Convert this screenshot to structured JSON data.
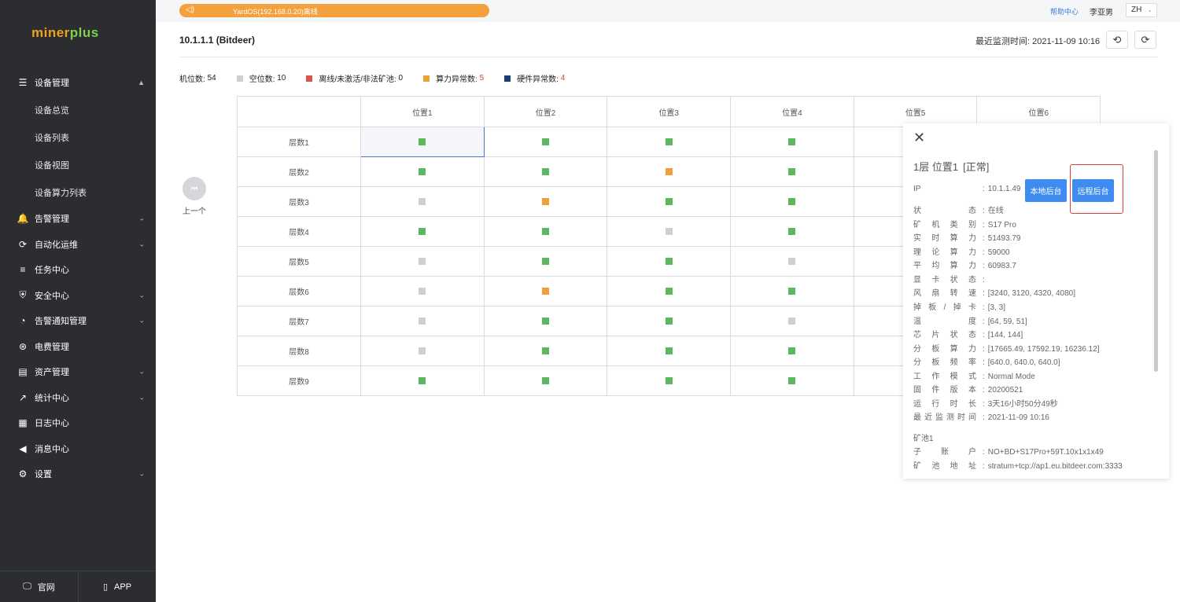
{
  "sidebar": {
    "logo_left": "miner",
    "logo_right": "plus",
    "menu": [
      {
        "label": "设备管理",
        "icon": "list-icon",
        "expanded": true
      },
      {
        "label": "告警管理",
        "icon": "bell-icon"
      },
      {
        "label": "自动化运维",
        "icon": "refresh-icon"
      },
      {
        "label": "任务中心",
        "icon": "task-list-icon"
      },
      {
        "label": "安全中心",
        "icon": "shield-icon"
      },
      {
        "label": "告警通知管理",
        "icon": "notify-icon"
      },
      {
        "label": "电费管理",
        "icon": "money-icon"
      },
      {
        "label": "资产管理",
        "icon": "assets-icon"
      },
      {
        "label": "统计中心",
        "icon": "trend-icon"
      },
      {
        "label": "日志中心",
        "icon": "log-icon"
      },
      {
        "label": "消息中心",
        "icon": "speaker-icon"
      },
      {
        "label": "设置",
        "icon": "gear-icon"
      }
    ],
    "submenu": [
      "设备总览",
      "设备列表",
      "设备视图",
      "设备算力列表"
    ],
    "bottom": {
      "website": "官网",
      "app": "APP"
    }
  },
  "topbar": {
    "notice": "YardOS(192.168.0.20)离线",
    "help": "帮助中心",
    "user": "李亚男",
    "lang": "ZH"
  },
  "header": {
    "title": "10.1.1.1 (Bitdeer)",
    "last_check": "最近监测时间: 2021-11-09 10:16"
  },
  "legend": {
    "total_label": "机位数:",
    "total_value": "54",
    "empty_label": "空位数:",
    "empty_value": "10",
    "offline_label": "离线/未激活/非法矿池:",
    "offline_value": "0",
    "hash_label": "算力异常数:",
    "hash_value": "5",
    "hw_label": "硬件异常数:",
    "hw_value": "4",
    "colors": {
      "normal": "#5cb85c",
      "empty": "#cfcfcf",
      "offline": "#d9534f",
      "hash": "#f0a03a",
      "hw": "#1b3f74"
    }
  },
  "nav": {
    "prev": "上一个"
  },
  "grid": {
    "columns": [
      "位置1",
      "位置2",
      "位置3",
      "位置4",
      "位置5",
      "位置6"
    ],
    "rows": [
      {
        "label": "层数1",
        "cells": [
          "normal",
          "normal",
          "normal",
          "normal"
        ]
      },
      {
        "label": "层数2",
        "cells": [
          "normal",
          "normal",
          "hash",
          "normal"
        ]
      },
      {
        "label": "层数3",
        "cells": [
          "empty",
          "hash",
          "normal",
          "normal"
        ]
      },
      {
        "label": "层数4",
        "cells": [
          "normal",
          "normal",
          "empty",
          "normal"
        ]
      },
      {
        "label": "层数5",
        "cells": [
          "empty",
          "normal",
          "normal",
          "empty"
        ]
      },
      {
        "label": "层数6",
        "cells": [
          "empty",
          "hash",
          "normal",
          "normal"
        ]
      },
      {
        "label": "层数7",
        "cells": [
          "empty",
          "normal",
          "normal",
          "empty"
        ]
      },
      {
        "label": "层数8",
        "cells": [
          "empty",
          "normal",
          "normal",
          "normal"
        ]
      },
      {
        "label": "层数9",
        "cells": [
          "normal",
          "normal",
          "normal",
          "normal"
        ]
      }
    ]
  },
  "panel": {
    "title": "1层 位置1",
    "status": "[正常]",
    "local_btn": "本地后台",
    "remote_btn": "远程后台",
    "fields": [
      {
        "k": "IP",
        "v": "10.1.1.49"
      },
      {
        "k": "状态",
        "v": "在线"
      },
      {
        "k": "矿机类别",
        "v": "S17 Pro"
      },
      {
        "k": "实时算力",
        "v": "51493.79"
      },
      {
        "k": "理论算力",
        "v": "59000"
      },
      {
        "k": "平均算力",
        "v": "60983.7"
      },
      {
        "k": "显卡状态",
        "v": ""
      },
      {
        "k": "风扇转速",
        "v": "[3240, 3120, 4320, 4080]"
      },
      {
        "k": "掉板/掉卡",
        "v": "[3, 3]"
      },
      {
        "k": "温度",
        "v": "[64, 59, 51]"
      },
      {
        "k": "芯片状态",
        "v": "[144, 144]"
      },
      {
        "k": "分板算力",
        "v": "[17665.49, 17592.19, 16236.12]"
      },
      {
        "k": "分板频率",
        "v": "[640.0, 640.0, 640.0]"
      },
      {
        "k": "工作模式",
        "v": "Normal Mode"
      },
      {
        "k": "固件版本",
        "v": "20200521"
      },
      {
        "k": "运行时长",
        "v": "3天16小时50分49秒"
      },
      {
        "k": "最近监测时间",
        "v": "2021-11-09 10:16"
      }
    ],
    "pool_title": "矿池1",
    "pool_fields": [
      {
        "k": "子账户",
        "v": "NO+BD+S17Pro+59T.10x1x1x49"
      },
      {
        "k": "矿池地址",
        "v": "stratum+tcp://ap1.eu.bitdeer.com:3333"
      }
    ]
  }
}
